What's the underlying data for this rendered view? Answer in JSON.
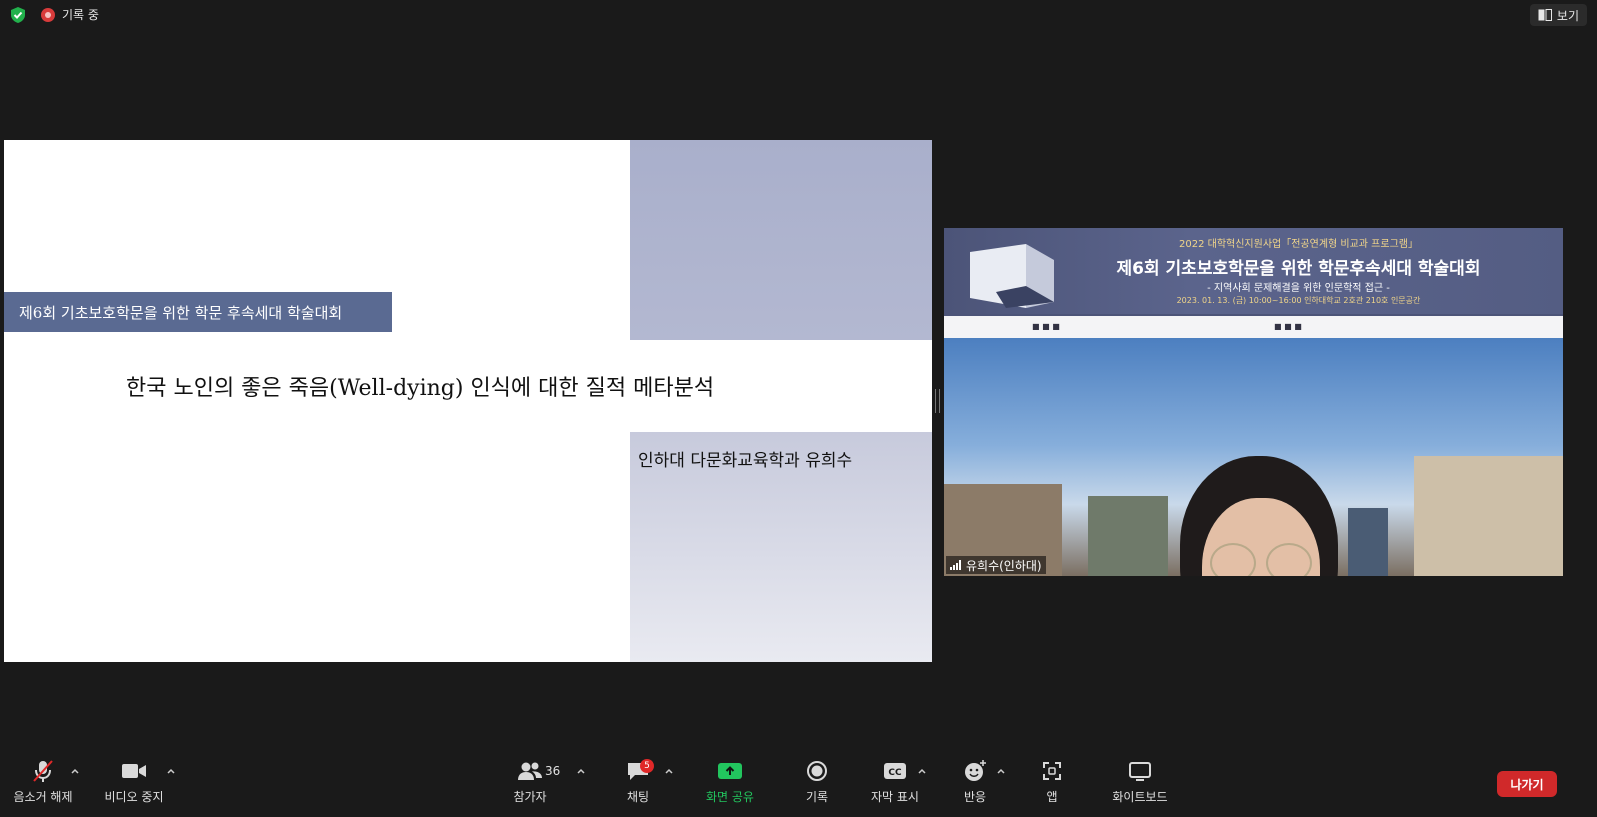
{
  "topbar": {
    "recording_label": "기록 중",
    "view_label": "보기"
  },
  "slide": {
    "band_text": "제6회 기초보호학문을 위한 학문 후속세대 학술대회",
    "title": "한국 노인의 좋은 죽음(Well-dying) 인식에 대한 질적 메타분석",
    "author": "인하대 다문화교육학과 유희수"
  },
  "video": {
    "banner_sub": "2022 대학혁신지원사업「전공연계형 비교과 프로그램」",
    "banner_title": "제6회 기초보호학문을 위한 학문후속세대 학술대회",
    "banner_tag": "- 지역사회 문제해결을 위한 인문학적 접근 -",
    "banner_date": "2023. 01. 13. (금) 10:00~16:00 인하대학교 2호관 210호 인문공간",
    "participant_name": "유희수(인하대)"
  },
  "toolbar": {
    "mute_label": "음소거 해제",
    "video_label": "비디오 중지",
    "participants_label": "참가자",
    "participants_count": "36",
    "chat_label": "채팅",
    "chat_badge": "5",
    "share_label": "화면 공유",
    "record_label": "기록",
    "captions_label": "자막 표시",
    "reactions_label": "반응",
    "apps_label": "앱",
    "whiteboard_label": "화이트보드",
    "leave_label": "나가기"
  },
  "colors": {
    "share_green": "#22c55e",
    "leave_red": "#d0292a",
    "slide_band": "#5a6a92"
  }
}
